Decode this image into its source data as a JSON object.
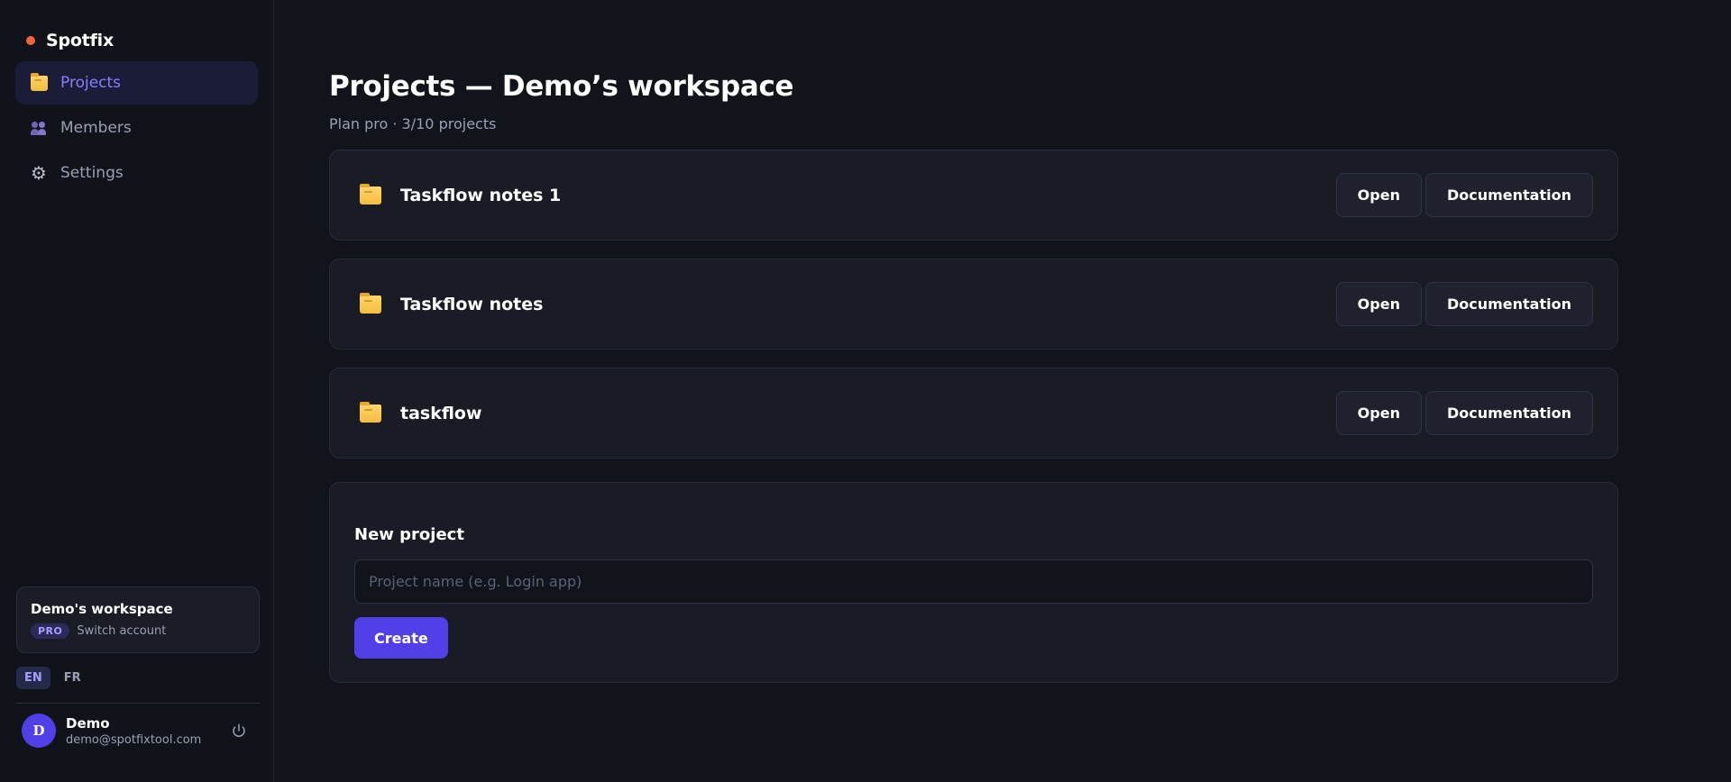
{
  "brand": {
    "name": "Spotfix",
    "dot_color": "#f2643a"
  },
  "nav": {
    "items": [
      {
        "label": "Projects",
        "icon": "folder-icon",
        "active": true
      },
      {
        "label": "Members",
        "icon": "members-icon",
        "active": false
      },
      {
        "label": "Settings",
        "icon": "gear-icon",
        "active": false
      }
    ]
  },
  "workspace": {
    "name": "Demo's workspace",
    "plan_badge": "PRO",
    "switch_label": "Switch account"
  },
  "languages": [
    {
      "code": "EN",
      "active": true
    },
    {
      "code": "FR",
      "active": false
    }
  ],
  "user": {
    "initial": "D",
    "name": "Demo",
    "email": "demo@spotfixtool.com"
  },
  "page": {
    "title": "Projects — Demo’s workspace",
    "subtitle": "Plan pro · 3/10 projects"
  },
  "projects": [
    {
      "name": "Taskflow notes 1",
      "open_label": "Open",
      "docs_label": "Documentation"
    },
    {
      "name": "Taskflow notes",
      "open_label": "Open",
      "docs_label": "Documentation"
    },
    {
      "name": "taskflow",
      "open_label": "Open",
      "docs_label": "Documentation"
    }
  ],
  "new_project": {
    "title": "New project",
    "placeholder": "Project name (e.g. Login app)",
    "value": "",
    "create_label": "Create"
  },
  "colors": {
    "accent": "#5140e8",
    "accent_text": "#8a7dff",
    "background": "#12141c",
    "card": "#191b25"
  }
}
